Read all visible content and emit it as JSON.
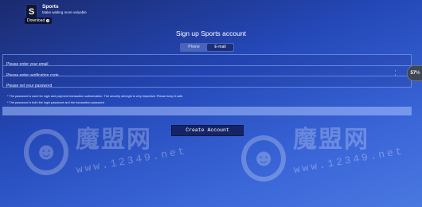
{
  "app": {
    "name": "Sports",
    "tagline": "Make waiting more valuable",
    "download_label": "Download",
    "download_badge": "d"
  },
  "page_title": "Sign up Sports account",
  "tabs": [
    {
      "label": "Phone",
      "active": false
    },
    {
      "label": "E-mail",
      "active": true
    }
  ],
  "fields": {
    "email_placeholder": "Please enter your email",
    "code_placeholder": "Please enter verification code",
    "password_placeholder": "Please set your password"
  },
  "notes": [
    "* The password is used for login and payment transaction authorization. The security strength is very important. Please keep it safe.",
    "* The password is both the login password and the transaction password"
  ],
  "create_button": "Create Account",
  "float_badge": {
    "value": "57",
    "unit": "%"
  },
  "watermark": {
    "brand": "魔盟网",
    "url": "www.12349.net"
  }
}
